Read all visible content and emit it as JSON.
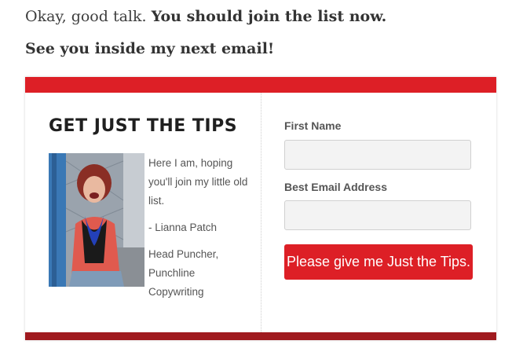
{
  "intro": {
    "line1_plain": "Okay, good talk. ",
    "line1_bold": "You should join the list now.",
    "line2": "See you inside my next email!"
  },
  "optin": {
    "heading": "GET JUST THE TIPS",
    "bio": {
      "p1": "Here I am, hoping you'll join my little old list.",
      "p2": "- Lianna Patch",
      "p3": "Head Puncher, Punchline Copywriting"
    },
    "form": {
      "first_name_label": "First Name",
      "first_name_value": "",
      "email_label": "Best Email Address",
      "email_value": "",
      "submit_label": "Please give me Just the Tips."
    },
    "colors": {
      "accent": "#dd1f26",
      "accent_dark": "#a01a1f"
    }
  }
}
